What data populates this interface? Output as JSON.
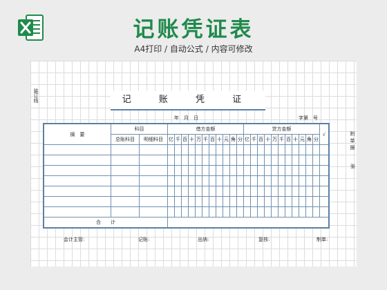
{
  "header": {
    "title": "记账凭证表",
    "subtitle": "A4打印 / 自动公式 / 内容可修改"
  },
  "sheet": {
    "side_note": "装订线",
    "voucher_title": "记 账 凭 证",
    "date_line": "年　月　日",
    "serial_label": "字第　号",
    "table": {
      "summary_header": "摘　要",
      "subject_header": "科目",
      "general_ledger": "总账科目",
      "detail_subject": "明细科目",
      "debit_header": "借方金额",
      "credit_header": "贷方金额",
      "check_header": "√",
      "digits": [
        "亿",
        "千",
        "百",
        "十",
        "万",
        "千",
        "百",
        "十",
        "元",
        "角",
        "分"
      ],
      "total_label": "合　　计",
      "body_rows": 7
    },
    "right_note": "附单据",
    "right_note2": "张",
    "footer": [
      "会计主管:",
      "记账:",
      "出纳:",
      "复核:",
      "制单:"
    ]
  }
}
